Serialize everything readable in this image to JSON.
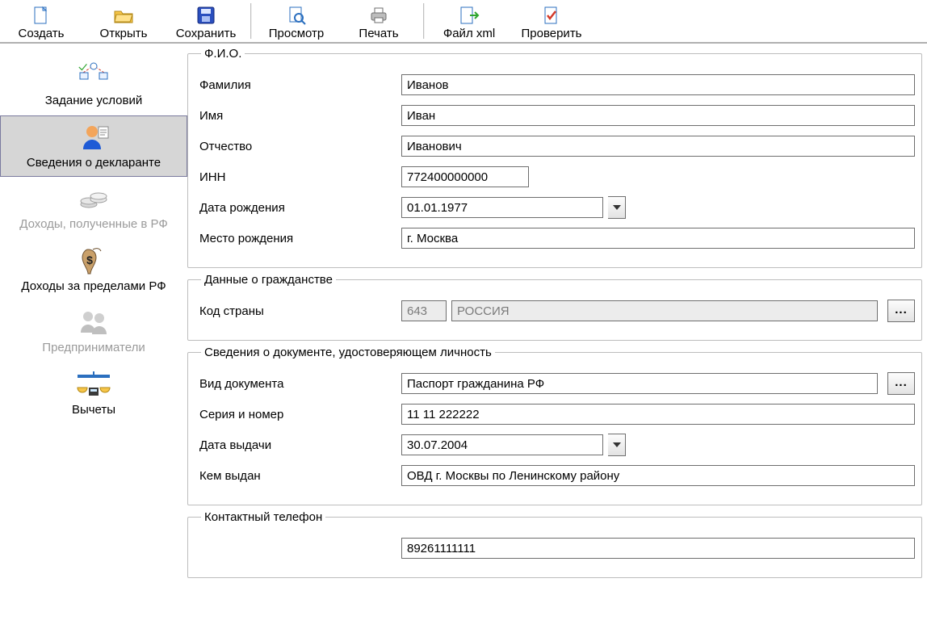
{
  "toolbar": {
    "create": "Создать",
    "open": "Открыть",
    "save": "Сохранить",
    "preview": "Просмотр",
    "print": "Печать",
    "file_xml": "Файл xml",
    "check": "Проверить"
  },
  "sidebar": {
    "items": [
      {
        "label": "Задание условий",
        "selected": false,
        "disabled": false,
        "icon": "conditions-icon"
      },
      {
        "label": "Сведения о декларанте",
        "selected": true,
        "disabled": false,
        "icon": "declarant-icon"
      },
      {
        "label": "Доходы, полученные в РФ",
        "selected": false,
        "disabled": true,
        "icon": "income-rf-icon"
      },
      {
        "label": "Доходы за пределами РФ",
        "selected": false,
        "disabled": false,
        "icon": "income-abroad-icon"
      },
      {
        "label": "Предприниматели",
        "selected": false,
        "disabled": true,
        "icon": "entrepreneurs-icon"
      },
      {
        "label": "Вычеты",
        "selected": false,
        "disabled": false,
        "icon": "deductions-icon"
      }
    ]
  },
  "groups": {
    "fio": "Ф.И.О.",
    "citizenship": "Данные о гражданстве",
    "identity": "Сведения о документе, удостоверяющем личность",
    "contact": "Контактный телефон"
  },
  "labels": {
    "surname": "Фамилия",
    "name": "Имя",
    "patronymic": "Отчество",
    "inn": "ИНН",
    "birth_date": "Дата рождения",
    "birth_place": "Место рождения",
    "country_code": "Код страны",
    "doc_type": "Вид документа",
    "doc_series": "Серия и номер",
    "doc_issue_date": "Дата выдачи",
    "doc_issued_by": "Кем выдан"
  },
  "values": {
    "surname": "Иванов",
    "name": "Иван",
    "patronymic": "Иванович",
    "inn": "772400000000",
    "birth_date": "01.01.1977",
    "birth_place": "г. Москва",
    "country_code": "643",
    "country_name": "РОССИЯ",
    "doc_type": "Паспорт гражданина РФ",
    "doc_series": "11 11 222222",
    "doc_issue_date": "30.07.2004",
    "doc_issued_by": "ОВД г. Москвы по Ленинскому району",
    "phone": "89261111111"
  },
  "ellipsis": "..."
}
